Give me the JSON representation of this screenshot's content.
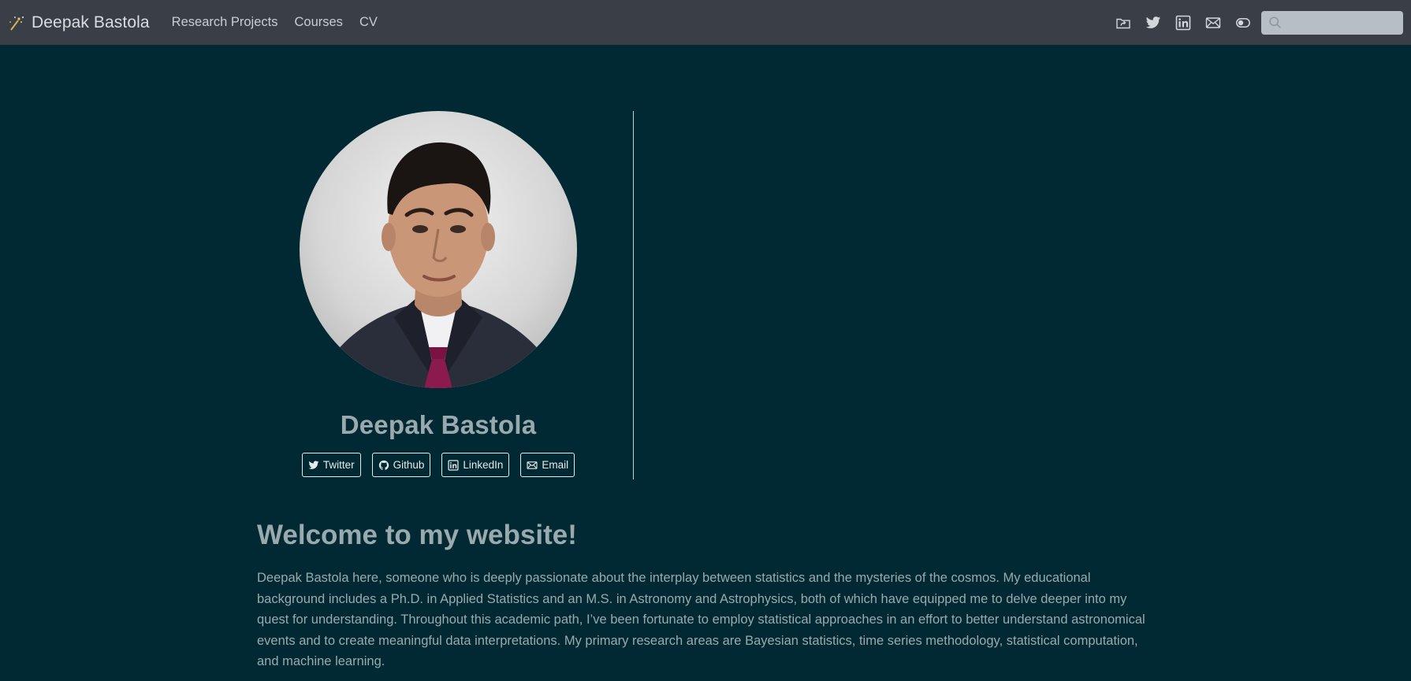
{
  "navbar": {
    "brand_title": "Deepak Bastola",
    "links": [
      {
        "label": "Research Projects"
      },
      {
        "label": "Courses"
      },
      {
        "label": "CV"
      }
    ],
    "icons": [
      "folder-share-icon",
      "twitter-icon",
      "linkedin-icon",
      "envelope-icon",
      "toggle-icon"
    ],
    "search": {
      "placeholder": ""
    }
  },
  "profile": {
    "name": "Deepak Bastola",
    "links": [
      {
        "label": "Twitter",
        "icon": "twitter-icon"
      },
      {
        "label": "Github",
        "icon": "github-icon"
      },
      {
        "label": "LinkedIn",
        "icon": "linkedin-icon"
      },
      {
        "label": "Email",
        "icon": "envelope-icon"
      }
    ]
  },
  "content": {
    "heading": "Welcome to my website!",
    "intro": "Deepak Bastola here, someone who is deeply passionate about the interplay between statistics and the mysteries of the cosmos. My educational background includes a Ph.D. in Applied Statistics and an M.S. in Astronomy and Astrophysics, both of which have equipped me to delve deeper into my quest for understanding. Throughout this academic path, I’ve been fortunate to employ statistical approaches in an effort to better understand astronomical events and to create meaningful data interpretations. My primary research areas are Bayesian statistics, time series methodology, statistical computation, and machine learning."
  },
  "colors": {
    "page_background": "#012933",
    "navbar_background": "#3a3f47",
    "text_muted": "#9aa9ae",
    "button_border": "#e6eaec"
  }
}
